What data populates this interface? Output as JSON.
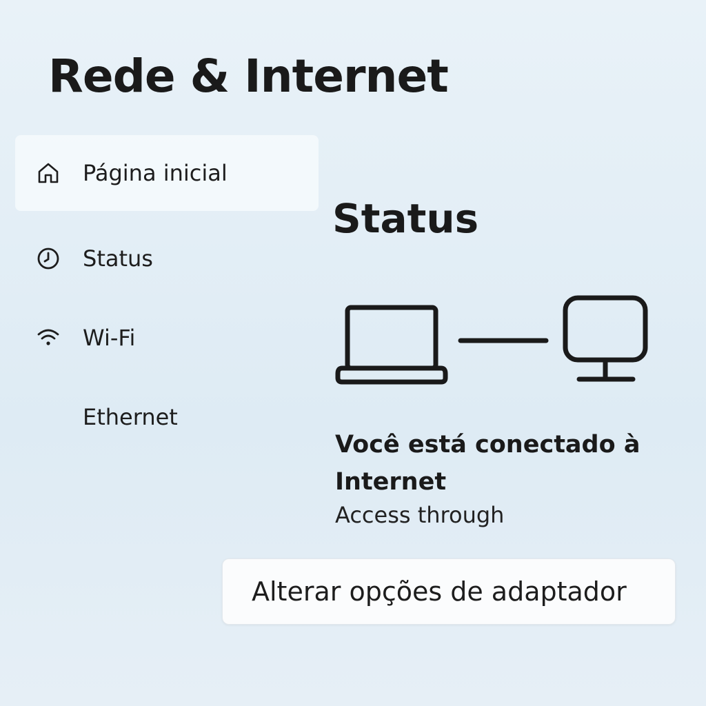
{
  "header": {
    "title": "Rede & Internet"
  },
  "sidebar": {
    "items": [
      {
        "label": "Página inicial",
        "icon": "home-icon",
        "active": true
      },
      {
        "label": "Status",
        "icon": "clock-icon",
        "active": false
      },
      {
        "label": "Wi-Fi",
        "icon": "wifi-icon",
        "active": false
      },
      {
        "label": "Ethernet",
        "icon": "",
        "active": false
      }
    ]
  },
  "main": {
    "section_title": "Status",
    "diagram": {
      "left_icon": "laptop-icon",
      "right_icon": "monitor-icon"
    },
    "status_heading": "Você está conectado à Internet",
    "status_sub": "Access through",
    "adapter_button_label": "Alterar opções de adaptador"
  },
  "colors": {
    "background": "#e4eef5",
    "text": "#1a1a1a",
    "active_item_bg": "#f6fafd",
    "button_bg": "#fbfcfd"
  }
}
